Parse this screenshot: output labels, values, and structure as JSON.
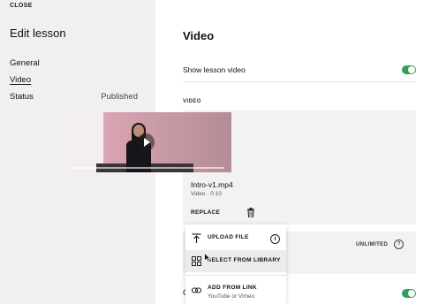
{
  "sidebar": {
    "close_label": "CLOSE",
    "title": "Edit lesson",
    "items": [
      {
        "label": "General"
      },
      {
        "label": "Video"
      },
      {
        "label": "Status"
      }
    ],
    "status_value": "Published"
  },
  "main": {
    "title": "Video",
    "show_video_label": "Show lesson video",
    "show_video_on": true,
    "section_label": "VIDEO",
    "file": {
      "name": "Intro-v1.mp4",
      "meta": "Video · 0:10"
    },
    "replace_label": "REPLACE",
    "unlimited_label": "UNLIMITED",
    "help_glyph": "?",
    "second_toggle_on": true
  },
  "replace_menu": {
    "items": [
      {
        "label": "UPLOAD FILE",
        "icon": "upload-icon",
        "info_glyph": "i"
      },
      {
        "label": "SELECT FROM LIBRARY",
        "icon": "library-grid-icon"
      },
      {
        "label": "ADD FROM LINK",
        "icon": "link-icon",
        "sub": "YouTube or Vimeo"
      }
    ]
  },
  "colors": {
    "toggle_on": "#2e9e5b",
    "sidebar_bg": "#f0f0f0",
    "card_bg": "#f2f2f2"
  }
}
